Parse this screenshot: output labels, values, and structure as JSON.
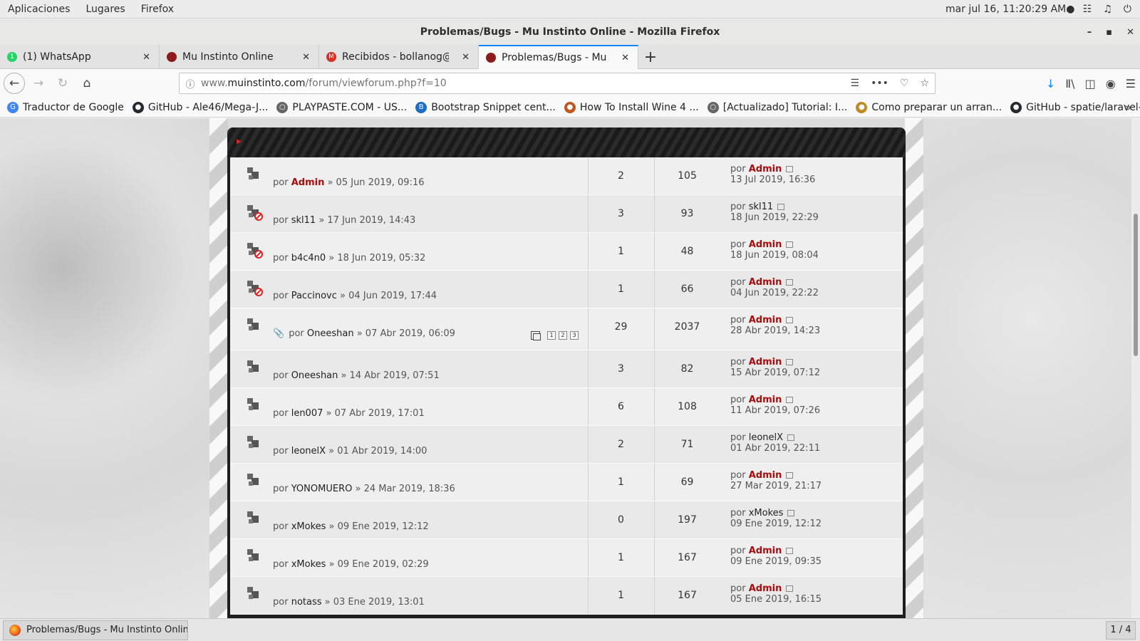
{
  "topbar": {
    "menus": [
      "Aplicaciones",
      "Lugares",
      "Firefox"
    ],
    "clock": "mar jul 16, 11:20:29 AM●",
    "icons": [
      "network-icon",
      "volume-icon",
      "power-icon"
    ]
  },
  "window": {
    "title": "Problemas/Bugs - Mu Instinto Online - Mozilla Firefox",
    "minimize": "–",
    "maximize": "▪",
    "close": "✕"
  },
  "tabs": [
    {
      "label": "(1) WhatsApp",
      "icon": "whatsapp-icon",
      "color": "#25d366",
      "glyph": "1"
    },
    {
      "label": "Mu Instinto Online",
      "icon": "mu-icon",
      "color": "#8e1b1b",
      "glyph": ""
    },
    {
      "label": "Recibidos - bollanog@gm",
      "icon": "gmail-icon",
      "color": "#d93025",
      "glyph": "M"
    },
    {
      "label": "Problemas/Bugs - Mu Instint",
      "icon": "mu-icon",
      "color": "#8e1b1b",
      "glyph": ""
    }
  ],
  "tab_close": "✕",
  "new_tab": "+",
  "nav": {
    "back": "←",
    "forward": "→",
    "reload": "↻",
    "home": "⌂",
    "url_prefix": "www.",
    "url_domain": "muinstinto.com",
    "url_path": "/forum/viewforum.php?f=10",
    "url_tools": [
      "☰",
      "•••",
      "♡",
      "☆"
    ],
    "right_tools": [
      "↓",
      "Ⅱ\\",
      "◫",
      "◉",
      "☰"
    ]
  },
  "bookmarks": [
    {
      "label": "Traductor de Google",
      "color": "#4285f4",
      "glyph": "G"
    },
    {
      "label": "GitHub - Ale46/Mega-J...",
      "color": "#24292e",
      "glyph": "●"
    },
    {
      "label": "PLAYPASTE.COM - US...",
      "color": "#666666",
      "glyph": "○"
    },
    {
      "label": "Bootstrap Snippet cent...",
      "color": "#1e6bc4",
      "glyph": "B"
    },
    {
      "label": "How To Install Wine 4 ...",
      "color": "#c0571c",
      "glyph": "●"
    },
    {
      "label": "[Actualizado] Tutorial: I...",
      "color": "#666666",
      "glyph": "○"
    },
    {
      "label": "Como preparar un arran...",
      "color": "#c08a22",
      "glyph": "●"
    },
    {
      "label": "GitHub - spatie/laravel-...",
      "color": "#24292e",
      "glyph": "●"
    }
  ],
  "bookmarks_more": "»",
  "forum": {
    "header_arrow": "▶",
    "by": "por",
    "rows": [
      {
        "author": "Admin",
        "admin": true,
        "date": "» 05 Jun 2019, 09:16",
        "replies": "2",
        "views": "105",
        "last_author": "Admin",
        "last_admin": true,
        "last_date": "13 Jul 2019, 16:36",
        "locked": false
      },
      {
        "author": "skl11",
        "admin": false,
        "date": "» 17 Jun 2019, 14:43",
        "replies": "3",
        "views": "93",
        "last_author": "skl11",
        "last_admin": false,
        "last_date": "18 Jun 2019, 22:29",
        "locked": true
      },
      {
        "author": "b4c4n0",
        "admin": false,
        "date": "» 18 Jun 2019, 05:32",
        "replies": "1",
        "views": "48",
        "last_author": "Admin",
        "last_admin": true,
        "last_date": "18 Jun 2019, 08:04",
        "locked": true
      },
      {
        "author": "Paccinovc",
        "admin": false,
        "date": "» 04 Jun 2019, 17:44",
        "replies": "1",
        "views": "66",
        "last_author": "Admin",
        "last_admin": true,
        "last_date": "04 Jun 2019, 22:22",
        "locked": true
      },
      {
        "author": "Oneeshan",
        "admin": false,
        "date": "» 07 Abr 2019, 06:09",
        "replies": "29",
        "views": "2037",
        "last_author": "Admin",
        "last_admin": true,
        "last_date": "28 Abr 2019, 14:23",
        "locked": false,
        "attachment": true,
        "pages": [
          "1",
          "2",
          "3"
        ]
      },
      {
        "author": "Oneeshan",
        "admin": false,
        "date": "» 14 Abr 2019, 07:51",
        "replies": "3",
        "views": "82",
        "last_author": "Admin",
        "last_admin": true,
        "last_date": "15 Abr 2019, 07:12",
        "locked": false
      },
      {
        "author": "len007",
        "admin": false,
        "date": "» 07 Abr 2019, 17:01",
        "replies": "6",
        "views": "108",
        "last_author": "Admin",
        "last_admin": true,
        "last_date": "11 Abr 2019, 07:26",
        "locked": false
      },
      {
        "author": "leonelX",
        "admin": false,
        "date": "» 01 Abr 2019, 14:00",
        "replies": "2",
        "views": "71",
        "last_author": "leonelX",
        "last_admin": false,
        "last_date": "01 Abr 2019, 22:11",
        "locked": false
      },
      {
        "author": "YONOMUERO",
        "admin": false,
        "date": "» 24 Mar 2019, 18:36",
        "replies": "1",
        "views": "69",
        "last_author": "Admin",
        "last_admin": true,
        "last_date": "27 Mar 2019, 21:17",
        "locked": false
      },
      {
        "author": "xMokes",
        "admin": false,
        "date": "» 09 Ene 2019, 12:12",
        "replies": "0",
        "views": "197",
        "last_author": "xMokes",
        "last_admin": false,
        "last_date": "09 Ene 2019, 12:12",
        "locked": false
      },
      {
        "author": "xMokes",
        "admin": false,
        "date": "» 09 Ene 2019, 02:29",
        "replies": "1",
        "views": "167",
        "last_author": "Admin",
        "last_admin": true,
        "last_date": "09 Ene 2019, 09:35",
        "locked": false
      },
      {
        "author": "notass",
        "admin": false,
        "date": "» 03 Ene 2019, 13:01",
        "replies": "1",
        "views": "167",
        "last_author": "Admin",
        "last_admin": true,
        "last_date": "05 Ene 2019, 16:15",
        "locked": false
      }
    ]
  },
  "taskbar": {
    "task_label": "Problemas/Bugs - Mu Instinto Onlin...",
    "workspace": "1 / 4"
  }
}
